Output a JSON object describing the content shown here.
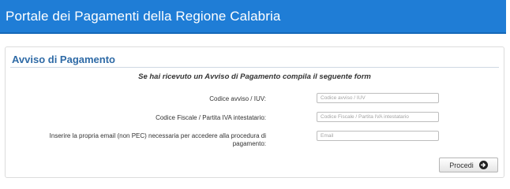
{
  "header": {
    "title": "Portale dei Pagamenti della Regione Calabria"
  },
  "panel": {
    "title": "Avviso di Pagamento",
    "subtitle": "Se hai ricevuto un Avviso di Pagamento compila il seguente form"
  },
  "form": {
    "codice_label": "Codice avviso / IUV:",
    "codice_placeholder": "Codice avviso / IUV",
    "codice_value": "",
    "cf_label": "Codice Fiscale / Partita IVA intestatario:",
    "cf_placeholder": "Codice Fiscale / Partita IVA intestatario",
    "cf_value": "",
    "email_label_line1": "Inserire la propria email (non PEC) necessaria per accedere alla procedura di",
    "email_label_line2": "pagamento:",
    "email_placeholder": "Email",
    "email_value": ""
  },
  "actions": {
    "proceed_label": "Procedi",
    "proceed_icon": "arrow-right-circle-icon"
  },
  "colors": {
    "header_bg": "#1f7dd6",
    "panel_title": "#2e6aa6"
  }
}
